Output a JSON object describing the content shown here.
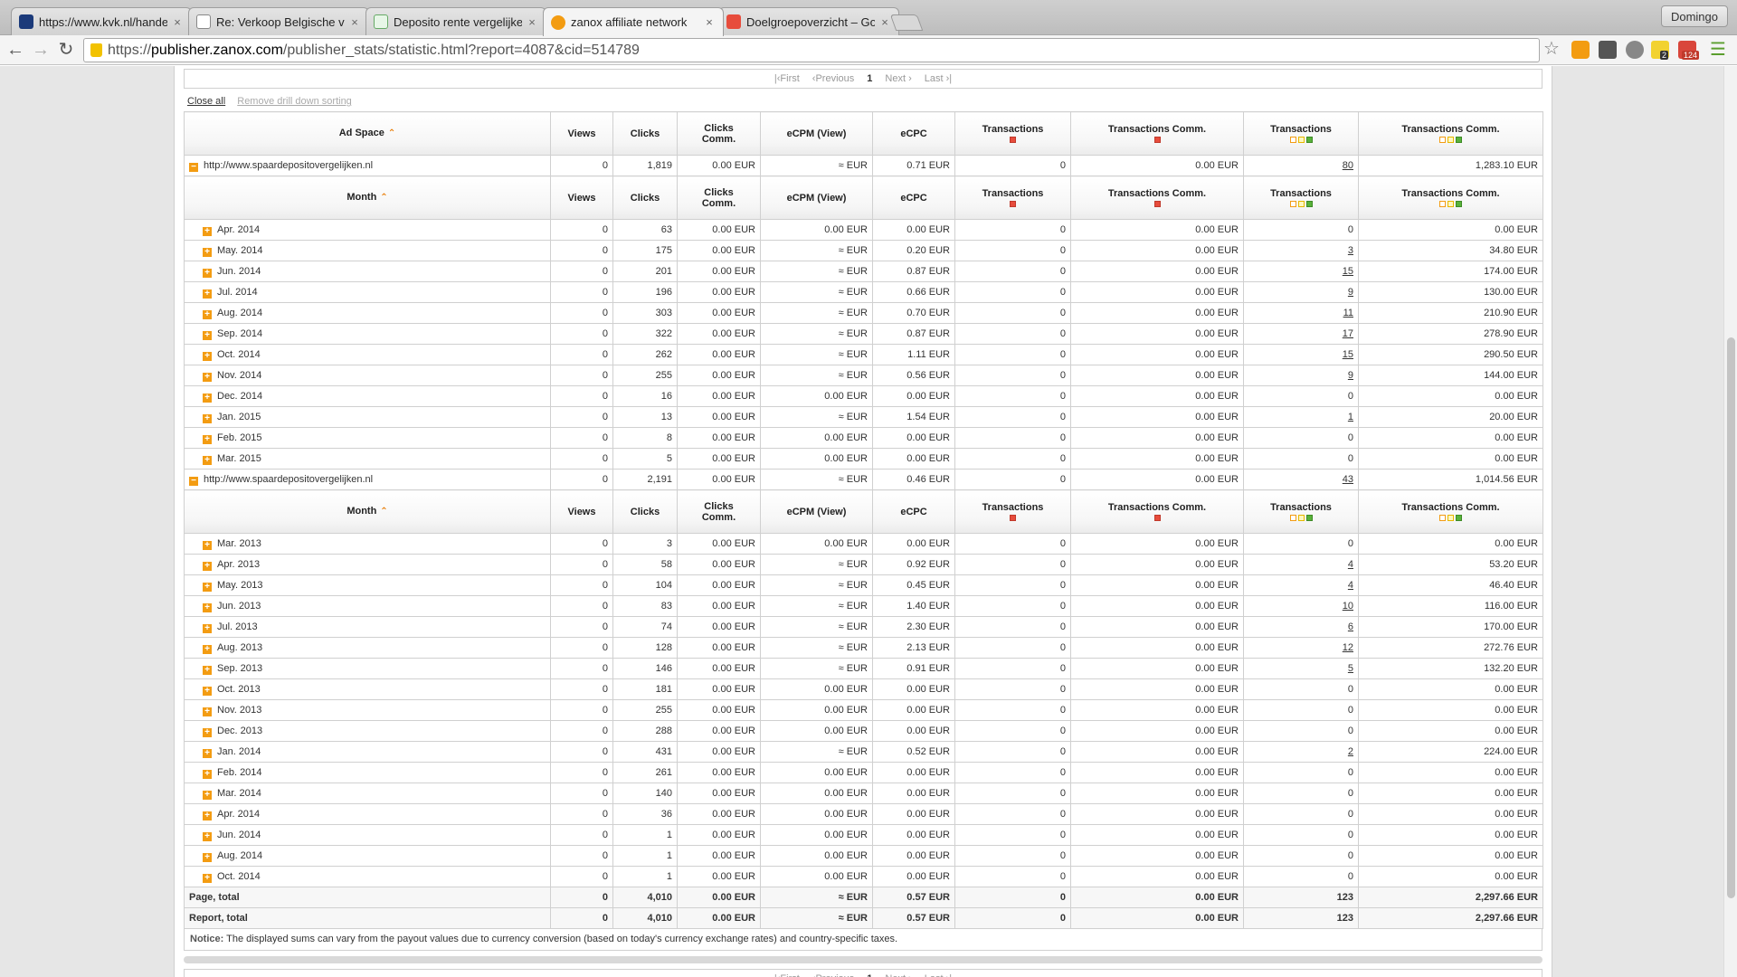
{
  "browser": {
    "tabs": [
      {
        "label": "https://www.kvk.nl/handel",
        "favicon_color": "#1b3a7a"
      },
      {
        "label": "Re: Verkoop Belgische verz",
        "favicon_color": "#ffffff"
      },
      {
        "label": "Deposito rente vergelijken",
        "favicon_color": "#e7f6e7"
      },
      {
        "label": "zanox affiliate network",
        "favicon_color": "#f39c12"
      },
      {
        "label": "Doelgroepoverzicht – Goo",
        "favicon_color": "#e74c3c"
      }
    ],
    "tab_close": "×",
    "profile": "Domingo",
    "url_scheme": "https://",
    "url_host": "publisher.zanox.com",
    "url_path": "/publisher_stats/statistic.html?report=4087&cid=514789",
    "badge_a": "2",
    "badge_b": "124"
  },
  "pager": {
    "first": "First",
    "previous": "Previous",
    "current": "1",
    "next": "Next",
    "last": "Last"
  },
  "options": {
    "close_all": "Close all",
    "remove_sorting": "Remove drill down sorting"
  },
  "headers": {
    "ad_space": "Ad Space",
    "month": "Month",
    "views": "Views",
    "clicks": "Clicks",
    "clicks_comm_1": "Clicks",
    "clicks_comm_2": "Comm.",
    "ecpm": "eCPM (View)",
    "ecpc": "eCPC",
    "transactions": "Transactions",
    "transactions_comm": "Transactions Comm."
  },
  "groups": [
    {
      "name": "http://www.spaardepositovergelijken.nl",
      "summary": [
        "0",
        "1,819",
        "0.00 EUR",
        "≈ EUR",
        "0.71 EUR",
        "0",
        "0.00 EUR",
        "80",
        "1,283.10 EUR"
      ],
      "rows": [
        [
          "Apr. 2014",
          "0",
          "63",
          "0.00 EUR",
          "0.00 EUR",
          "0.00 EUR",
          "0",
          "0.00 EUR",
          "0",
          "0.00 EUR"
        ],
        [
          "May. 2014",
          "0",
          "175",
          "0.00 EUR",
          "≈ EUR",
          "0.20 EUR",
          "0",
          "0.00 EUR",
          "3",
          "34.80 EUR"
        ],
        [
          "Jun. 2014",
          "0",
          "201",
          "0.00 EUR",
          "≈ EUR",
          "0.87 EUR",
          "0",
          "0.00 EUR",
          "15",
          "174.00 EUR"
        ],
        [
          "Jul. 2014",
          "0",
          "196",
          "0.00 EUR",
          "≈ EUR",
          "0.66 EUR",
          "0",
          "0.00 EUR",
          "9",
          "130.00 EUR"
        ],
        [
          "Aug. 2014",
          "0",
          "303",
          "0.00 EUR",
          "≈ EUR",
          "0.70 EUR",
          "0",
          "0.00 EUR",
          "11",
          "210.90 EUR"
        ],
        [
          "Sep. 2014",
          "0",
          "322",
          "0.00 EUR",
          "≈ EUR",
          "0.87 EUR",
          "0",
          "0.00 EUR",
          "17",
          "278.90 EUR"
        ],
        [
          "Oct. 2014",
          "0",
          "262",
          "0.00 EUR",
          "≈ EUR",
          "1.11 EUR",
          "0",
          "0.00 EUR",
          "15",
          "290.50 EUR"
        ],
        [
          "Nov. 2014",
          "0",
          "255",
          "0.00 EUR",
          "≈ EUR",
          "0.56 EUR",
          "0",
          "0.00 EUR",
          "9",
          "144.00 EUR"
        ],
        [
          "Dec. 2014",
          "0",
          "16",
          "0.00 EUR",
          "0.00 EUR",
          "0.00 EUR",
          "0",
          "0.00 EUR",
          "0",
          "0.00 EUR"
        ],
        [
          "Jan. 2015",
          "0",
          "13",
          "0.00 EUR",
          "≈ EUR",
          "1.54 EUR",
          "0",
          "0.00 EUR",
          "1",
          "20.00 EUR"
        ],
        [
          "Feb. 2015",
          "0",
          "8",
          "0.00 EUR",
          "0.00 EUR",
          "0.00 EUR",
          "0",
          "0.00 EUR",
          "0",
          "0.00 EUR"
        ],
        [
          "Mar. 2015",
          "0",
          "5",
          "0.00 EUR",
          "0.00 EUR",
          "0.00 EUR",
          "0",
          "0.00 EUR",
          "0",
          "0.00 EUR"
        ]
      ]
    },
    {
      "name": "http://www.spaardepositovergelijken.nl",
      "summary": [
        "0",
        "2,191",
        "0.00 EUR",
        "≈ EUR",
        "0.46 EUR",
        "0",
        "0.00 EUR",
        "43",
        "1,014.56 EUR"
      ],
      "rows": [
        [
          "Mar. 2013",
          "0",
          "3",
          "0.00 EUR",
          "0.00 EUR",
          "0.00 EUR",
          "0",
          "0.00 EUR",
          "0",
          "0.00 EUR"
        ],
        [
          "Apr. 2013",
          "0",
          "58",
          "0.00 EUR",
          "≈ EUR",
          "0.92 EUR",
          "0",
          "0.00 EUR",
          "4",
          "53.20 EUR"
        ],
        [
          "May. 2013",
          "0",
          "104",
          "0.00 EUR",
          "≈ EUR",
          "0.45 EUR",
          "0",
          "0.00 EUR",
          "4",
          "46.40 EUR"
        ],
        [
          "Jun. 2013",
          "0",
          "83",
          "0.00 EUR",
          "≈ EUR",
          "1.40 EUR",
          "0",
          "0.00 EUR",
          "10",
          "116.00 EUR"
        ],
        [
          "Jul. 2013",
          "0",
          "74",
          "0.00 EUR",
          "≈ EUR",
          "2.30 EUR",
          "0",
          "0.00 EUR",
          "6",
          "170.00 EUR"
        ],
        [
          "Aug. 2013",
          "0",
          "128",
          "0.00 EUR",
          "≈ EUR",
          "2.13 EUR",
          "0",
          "0.00 EUR",
          "12",
          "272.76 EUR"
        ],
        [
          "Sep. 2013",
          "0",
          "146",
          "0.00 EUR",
          "≈ EUR",
          "0.91 EUR",
          "0",
          "0.00 EUR",
          "5",
          "132.20 EUR"
        ],
        [
          "Oct. 2013",
          "0",
          "181",
          "0.00 EUR",
          "0.00 EUR",
          "0.00 EUR",
          "0",
          "0.00 EUR",
          "0",
          "0.00 EUR"
        ],
        [
          "Nov. 2013",
          "0",
          "255",
          "0.00 EUR",
          "0.00 EUR",
          "0.00 EUR",
          "0",
          "0.00 EUR",
          "0",
          "0.00 EUR"
        ],
        [
          "Dec. 2013",
          "0",
          "288",
          "0.00 EUR",
          "0.00 EUR",
          "0.00 EUR",
          "0",
          "0.00 EUR",
          "0",
          "0.00 EUR"
        ],
        [
          "Jan. 2014",
          "0",
          "431",
          "0.00 EUR",
          "≈ EUR",
          "0.52 EUR",
          "0",
          "0.00 EUR",
          "2",
          "224.00 EUR"
        ],
        [
          "Feb. 2014",
          "0",
          "261",
          "0.00 EUR",
          "0.00 EUR",
          "0.00 EUR",
          "0",
          "0.00 EUR",
          "0",
          "0.00 EUR"
        ],
        [
          "Mar. 2014",
          "0",
          "140",
          "0.00 EUR",
          "0.00 EUR",
          "0.00 EUR",
          "0",
          "0.00 EUR",
          "0",
          "0.00 EUR"
        ],
        [
          "Apr. 2014",
          "0",
          "36",
          "0.00 EUR",
          "0.00 EUR",
          "0.00 EUR",
          "0",
          "0.00 EUR",
          "0",
          "0.00 EUR"
        ],
        [
          "Jun. 2014",
          "0",
          "1",
          "0.00 EUR",
          "0.00 EUR",
          "0.00 EUR",
          "0",
          "0.00 EUR",
          "0",
          "0.00 EUR"
        ],
        [
          "Aug. 2014",
          "0",
          "1",
          "0.00 EUR",
          "0.00 EUR",
          "0.00 EUR",
          "0",
          "0.00 EUR",
          "0",
          "0.00 EUR"
        ],
        [
          "Oct. 2014",
          "0",
          "1",
          "0.00 EUR",
          "0.00 EUR",
          "0.00 EUR",
          "0",
          "0.00 EUR",
          "0",
          "0.00 EUR"
        ]
      ]
    }
  ],
  "totals": [
    [
      "Page, total",
      "0",
      "4,010",
      "0.00 EUR",
      "≈ EUR",
      "0.57 EUR",
      "0",
      "0.00 EUR",
      "123",
      "2,297.66 EUR"
    ],
    [
      "Report, total",
      "0",
      "4,010",
      "0.00 EUR",
      "≈ EUR",
      "0.57 EUR",
      "0",
      "0.00 EUR",
      "123",
      "2,297.66 EUR"
    ]
  ],
  "notice": {
    "label": "Notice:",
    "text": "The displayed sums can vary from the payout values due to currency conversion (based on today's currency exchange rates) and country-specific taxes."
  },
  "colors": {
    "accent": "#f39c12",
    "status_red": "#e74c3c",
    "status_green": "#58b23a"
  }
}
